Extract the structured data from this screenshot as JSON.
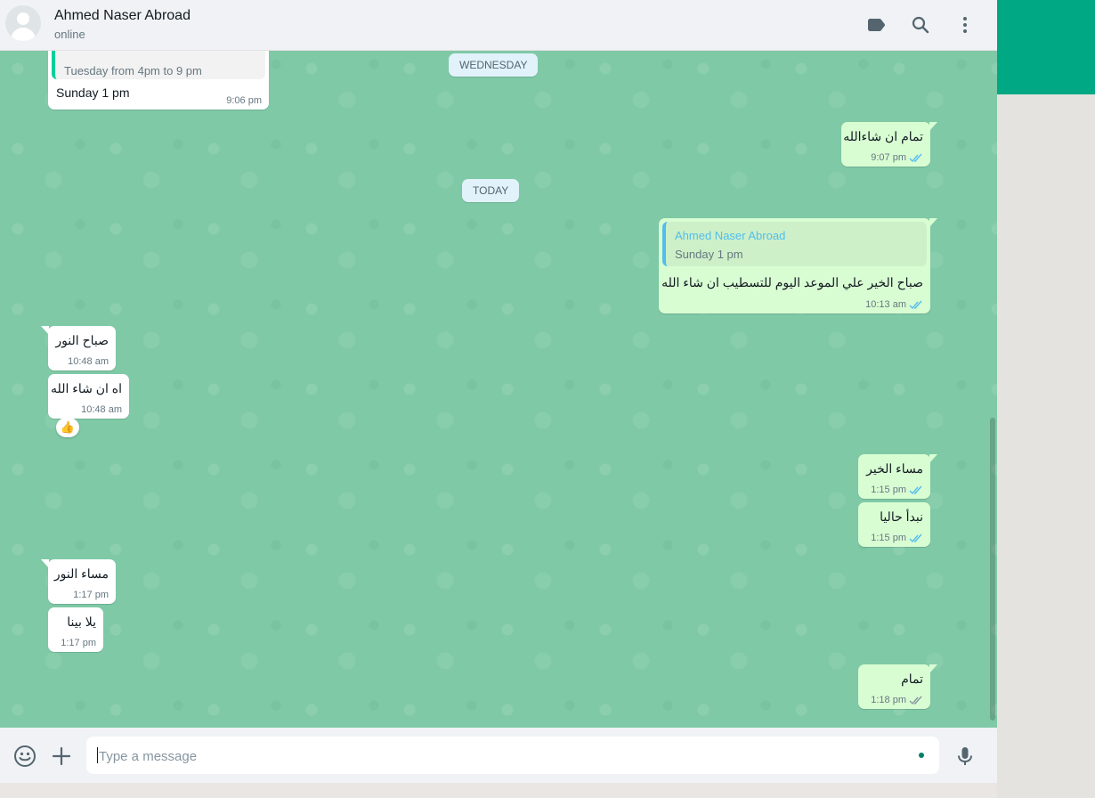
{
  "header": {
    "contact_name": "Ahmed Naser Abroad",
    "status": "online",
    "icons": [
      "label-icon",
      "search-icon",
      "menu-icon"
    ]
  },
  "date_chips": {
    "wednesday": "WEDNESDAY",
    "today": "TODAY"
  },
  "messages": [
    {
      "id": "m0",
      "direction": "incoming",
      "partial_text": "Tuesday from 4pm to 9 pm",
      "text": "Sunday 1 pm",
      "time": "9:06 pm"
    },
    {
      "id": "m1",
      "direction": "outgoing",
      "text": "تمام ان شاءالله",
      "time": "9:07 pm",
      "status": "read"
    },
    {
      "id": "m2",
      "direction": "outgoing",
      "quote_author": "Ahmed Naser Abroad",
      "quote_text": "Sunday 1 pm",
      "text": "صباح الخير علي الموعد اليوم للتسطيب ان شاء الله",
      "time": "10:13 am",
      "status": "read"
    },
    {
      "id": "m3",
      "direction": "incoming",
      "text": "صباح النور",
      "time": "10:48 am"
    },
    {
      "id": "m4",
      "direction": "incoming",
      "text": "اه ان شاء الله",
      "time": "10:48 am",
      "reaction": "👍"
    },
    {
      "id": "m5",
      "direction": "outgoing",
      "text": "مساء الخير",
      "time": "1:15 pm",
      "status": "read"
    },
    {
      "id": "m6",
      "direction": "outgoing",
      "text": "نبدأ حاليا",
      "time": "1:15 pm",
      "status": "read"
    },
    {
      "id": "m7",
      "direction": "incoming",
      "text": "مساء النور",
      "time": "1:17 pm"
    },
    {
      "id": "m8",
      "direction": "incoming",
      "text": "يلا بينا",
      "time": "1:17 pm"
    },
    {
      "id": "m9",
      "direction": "outgoing",
      "text": "تمام",
      "time": "1:18 pm",
      "status": "delivered"
    }
  ],
  "composer": {
    "placeholder": "Type a message",
    "value": "",
    "icons": [
      "emoji-icon",
      "attach-plus-icon",
      "mic-icon"
    ]
  },
  "colors": {
    "wallpaper": "#7fc9a6",
    "outgoing_bubble": "#d9fdd3",
    "incoming_bubble": "#ffffff",
    "read_tick": "#53bdeb",
    "delivered_tick": "#8696a0",
    "brand": "#00a884"
  }
}
